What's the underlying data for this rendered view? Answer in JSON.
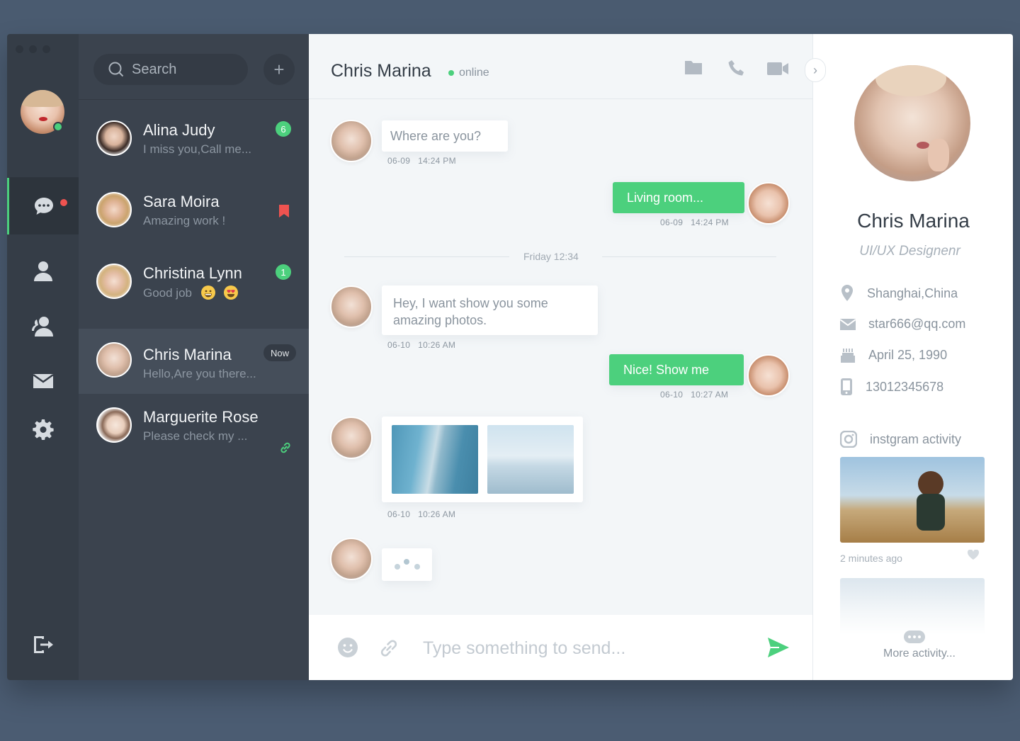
{
  "chat_header": {
    "title": "Chris Marina",
    "status": "online"
  },
  "search": {
    "placeholder": "Search"
  },
  "conversations": [
    {
      "name": "Alina Judy",
      "preview": "I miss you,Call me...",
      "badge": "6"
    },
    {
      "name": "Sara Moira",
      "preview": "Amazing work !",
      "flag": "bookmark-icon"
    },
    {
      "name": "Christina Lynn",
      "preview": "Good job",
      "badge": "1",
      "emojis": [
        "grinning-emoji",
        "heart-eyes-emoji"
      ]
    },
    {
      "name": "Chris Marina",
      "preview": "Hello,Are you there...",
      "tag": "Now"
    },
    {
      "name": "Marguerite Rose",
      "preview": "Please check my ...",
      "flag": "link-icon"
    }
  ],
  "messages": [
    {
      "dir": "in",
      "text": "Where are you?",
      "date": "06-09",
      "time": "14:24 PM"
    },
    {
      "dir": "out",
      "text": "Living room...",
      "date": "06-09",
      "time": "14:24 PM"
    },
    {
      "divider": "Friday 12:34"
    },
    {
      "dir": "in",
      "text": "Hey, I want show you some amazing photos.",
      "date": "06-10",
      "time": "10:26 AM"
    },
    {
      "dir": "out",
      "text": "Nice! Show me",
      "date": "06-10",
      "time": "10:27 AM"
    },
    {
      "dir": "in",
      "type": "photos",
      "photos": [
        "building-photo",
        "sea-photo"
      ],
      "date": "06-10",
      "time": "10:26 AM"
    },
    {
      "dir": "in",
      "type": "typing"
    }
  ],
  "composer": {
    "placeholder": "Type something to send..."
  },
  "profile": {
    "name": "Chris Marina",
    "role": "UI/UX Designenr",
    "location": "Shanghai,China",
    "email": "star666@qq.com",
    "birthday": "April 25, 1990",
    "phone": "13012345678",
    "instagram_label": "instgram activity",
    "post_time": "2 minutes ago",
    "more_label": "More activity..."
  },
  "colors": {
    "accent": "#4cd07d",
    "rail_bg": "#353d47",
    "list_bg": "#3b434e",
    "notification": "#ef5350",
    "bookmark": "#ef5350"
  }
}
